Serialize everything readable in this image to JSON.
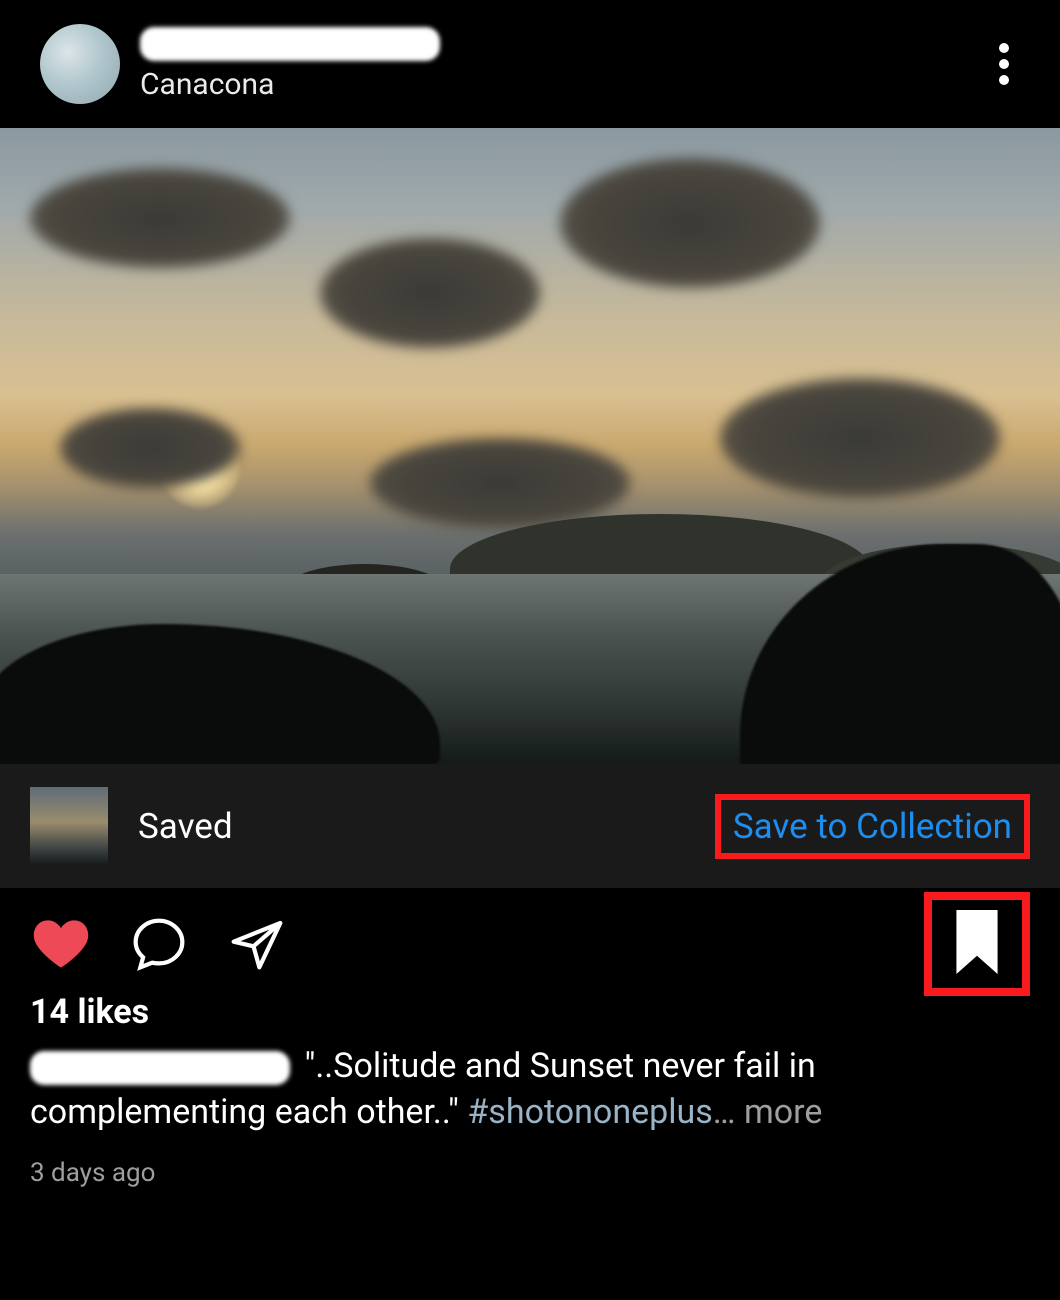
{
  "header": {
    "location": "Canacona"
  },
  "saved_bar": {
    "label": "Saved",
    "action": "Save to Collection"
  },
  "likes_text": "14 likes",
  "caption": {
    "text": "\"..Solitude and Sunset never fail in complementing each other..\" ",
    "hashtag": "#shotononeplus",
    "ellipsis": "… ",
    "more": "more"
  },
  "time_ago": "3 days ago",
  "colors": {
    "highlight_border": "#f71b1b",
    "link_blue": "#1d8df0",
    "heart_red": "#ed4956"
  }
}
